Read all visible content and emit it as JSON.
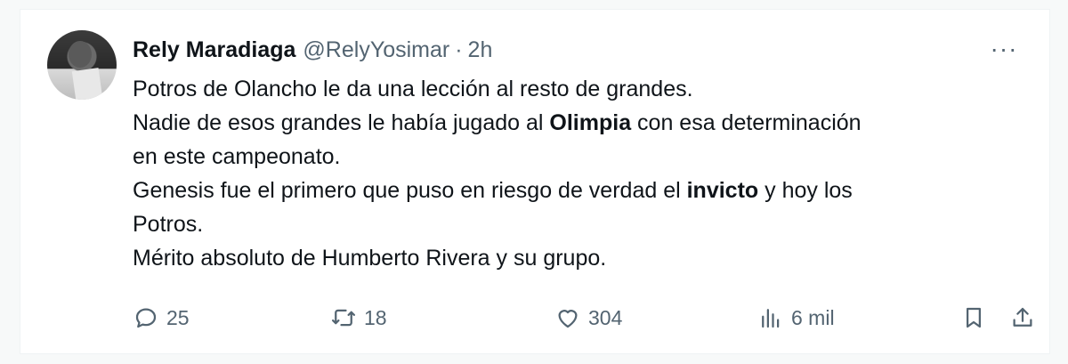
{
  "tweet": {
    "author_name": "Rely Maradiaga",
    "author_handle": "@RelyYosimar",
    "separator": "·",
    "time": "2h",
    "more_label": "···",
    "lines": {
      "l1": "Potros de Olancho le da una lección al resto de grandes.",
      "l2a": "Nadie de esos grandes le había jugado al ",
      "l2b": "Olimpia",
      "l2c": " con esa determinación",
      "l3": "en este campeonato.",
      "l4a": "Genesis fue el primero que puso en riesgo de verdad el ",
      "l4b": "invicto",
      "l4c": " y hoy los",
      "l5": "Potros.",
      "l6": "Mérito absoluto de Humberto Rivera y su grupo."
    }
  },
  "actions": {
    "replies": "25",
    "retweets": "18",
    "likes": "304",
    "views": "6 mil"
  },
  "icons": {
    "reply": "reply-bubble-icon",
    "retweet": "retweet-arrows-icon",
    "like": "heart-icon",
    "views": "bar-chart-icon",
    "bookmark": "bookmark-icon",
    "share": "share-upload-icon"
  },
  "colors": {
    "text": "#0f1419",
    "secondary": "#536471"
  }
}
